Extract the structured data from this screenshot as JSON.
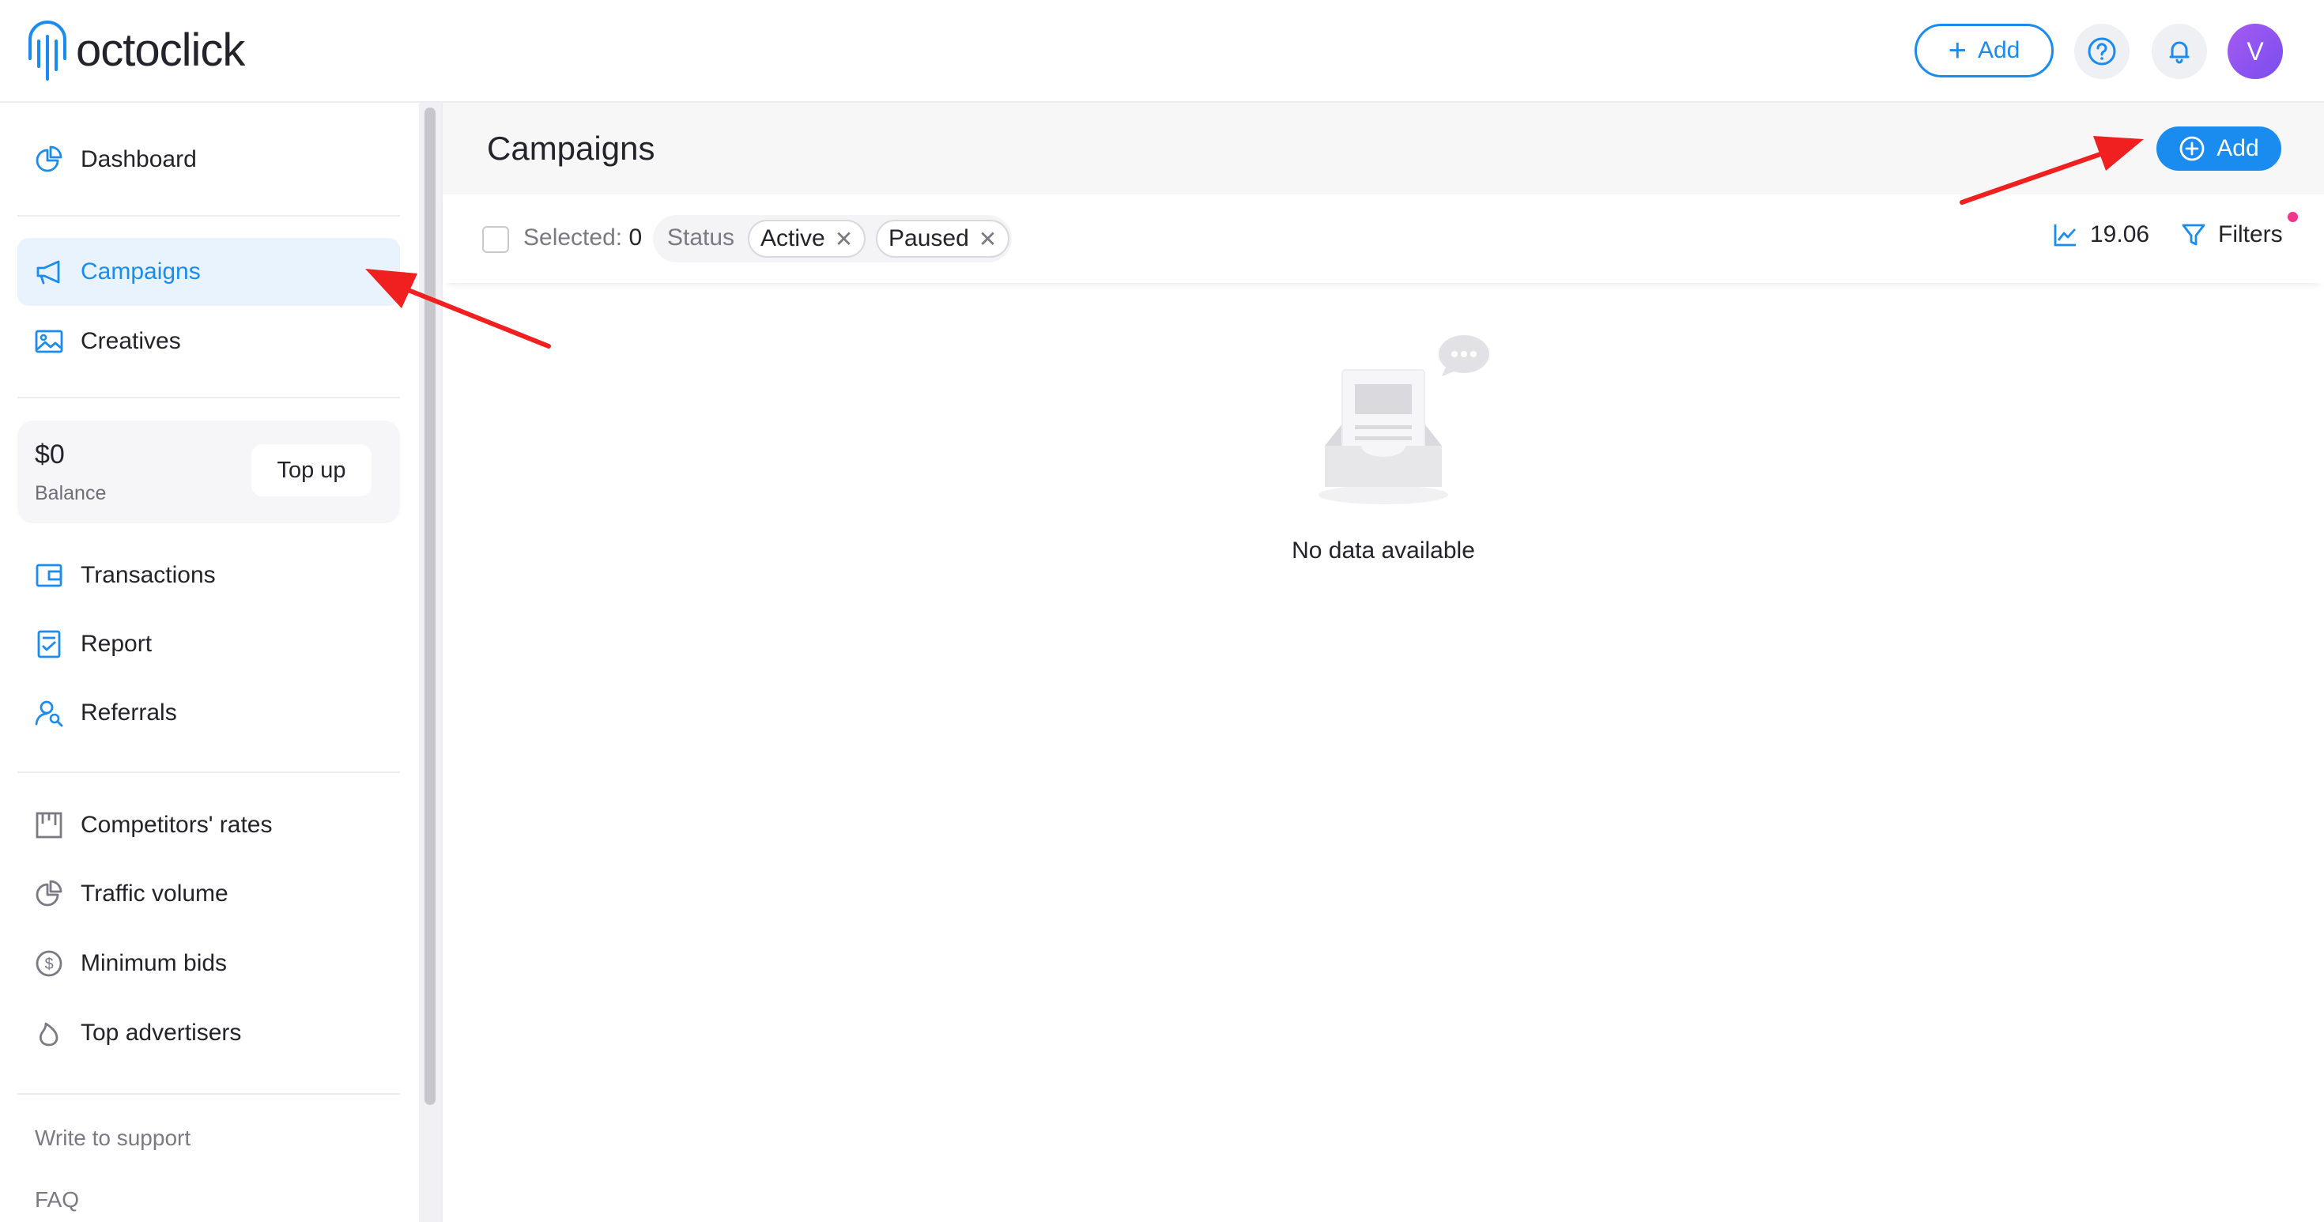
{
  "app": {
    "logo_text": "octoclick",
    "add_label": "Add",
    "avatar_initial": "V",
    "accent_color": "#1a8cf0",
    "icons": {
      "help": "help-circle-icon",
      "notifications": "bell-icon"
    }
  },
  "sidebar": {
    "dashboard": "Dashboard",
    "campaigns": "Campaigns",
    "creatives": "Creatives",
    "balance_amount": "$0",
    "balance_label": "Balance",
    "topup": "Top up",
    "transactions": "Transactions",
    "report": "Report",
    "referrals": "Referrals",
    "competitors_rates": "Competitors' rates",
    "traffic_volume": "Traffic volume",
    "minimum_bids": "Minimum bids",
    "top_advertisers": "Top advertisers",
    "write_to_support": "Write to support",
    "faq": "FAQ"
  },
  "main": {
    "title": "Campaigns",
    "add_label": "Add",
    "selected_label": "Selected:",
    "selected_count": "0",
    "status_label": "Status",
    "chips": [
      "Active",
      "Paused"
    ],
    "stat_value": "19.06",
    "filters_label": "Filters",
    "empty_text": "No data available"
  }
}
